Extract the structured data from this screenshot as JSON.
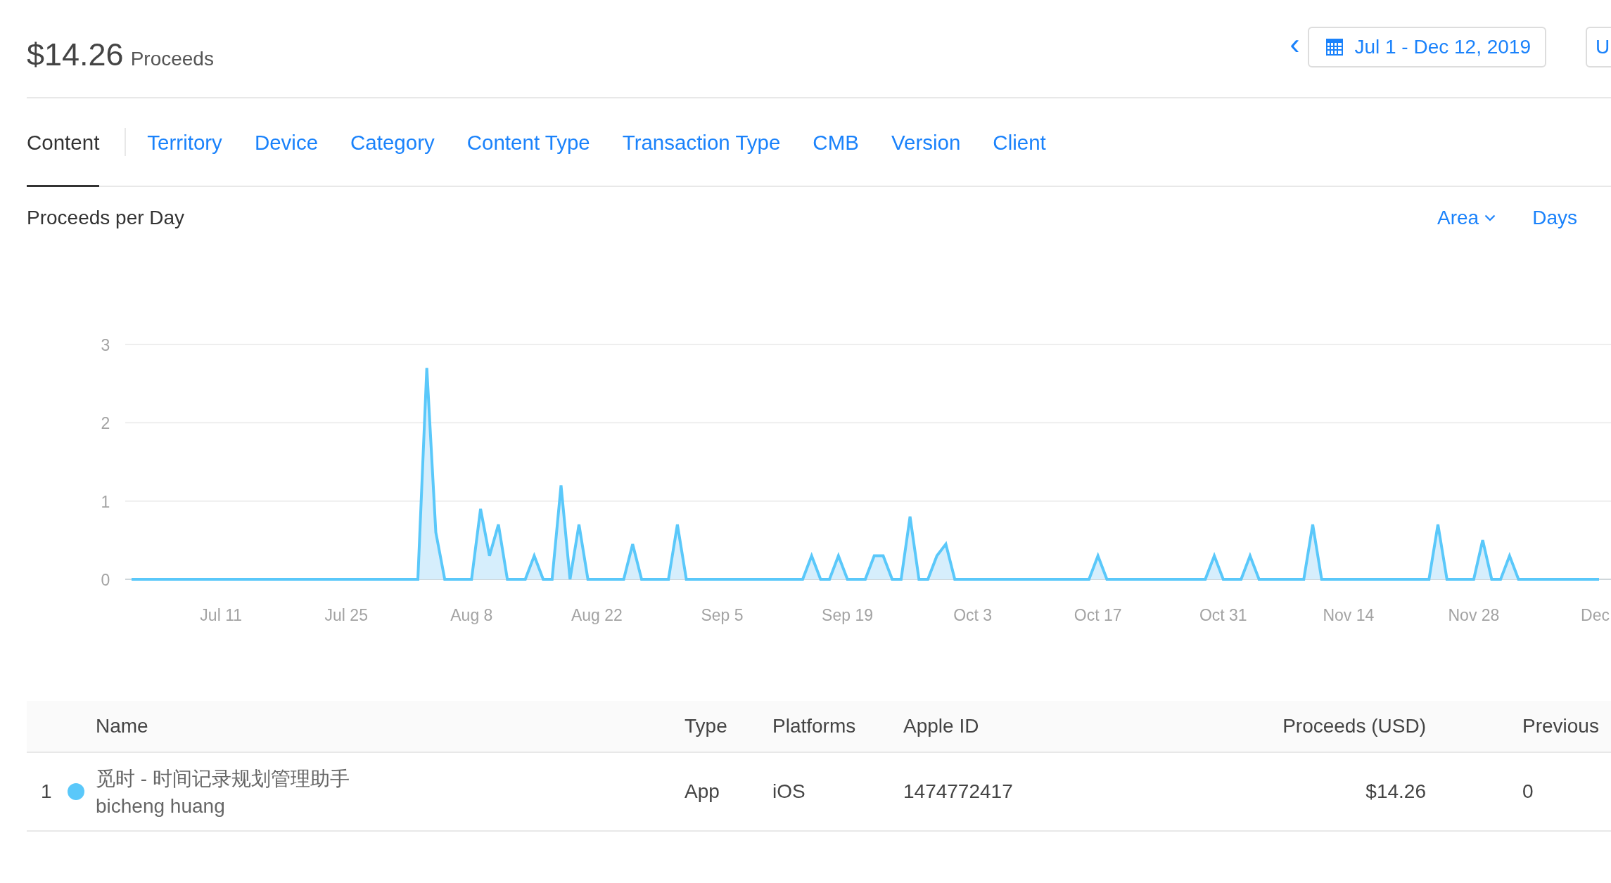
{
  "header": {
    "amount": "$14.26",
    "label": "Proceeds",
    "prev_button": "‹",
    "date_range": "Jul 1 - Dec 12, 2019",
    "next_button": "U"
  },
  "tabs": [
    {
      "label": "Content",
      "selected": true
    },
    {
      "label": "Territory",
      "selected": false
    },
    {
      "label": "Device",
      "selected": false
    },
    {
      "label": "Category",
      "selected": false
    },
    {
      "label": "Content Type",
      "selected": false
    },
    {
      "label": "Transaction Type",
      "selected": false
    },
    {
      "label": "CMB",
      "selected": false
    },
    {
      "label": "Version",
      "selected": false
    },
    {
      "label": "Client",
      "selected": false
    }
  ],
  "chart": {
    "chart_type_menu": "Area",
    "interval_menu": "Days",
    "chart_data": {
      "type": "area",
      "title": "Proceeds per Day",
      "categories": [
        null,
        null,
        null,
        null,
        null,
        null,
        null,
        null,
        null,
        null,
        "Jul 11",
        null,
        null,
        null,
        null,
        null,
        null,
        null,
        null,
        null,
        null,
        null,
        null,
        null,
        "Jul 25",
        null,
        null,
        null,
        null,
        null,
        null,
        null,
        null,
        null,
        null,
        null,
        null,
        null,
        "Aug 8",
        null,
        null,
        null,
        null,
        null,
        null,
        null,
        null,
        null,
        null,
        null,
        null,
        null,
        "Aug 22",
        null,
        null,
        null,
        null,
        null,
        null,
        null,
        null,
        null,
        null,
        null,
        null,
        null,
        "Sep 5",
        null,
        null,
        null,
        null,
        null,
        null,
        null,
        null,
        null,
        null,
        null,
        null,
        null,
        "Sep 19",
        null,
        null,
        null,
        null,
        null,
        null,
        null,
        null,
        null,
        null,
        null,
        null,
        null,
        "Oct 3",
        null,
        null,
        null,
        null,
        null,
        null,
        null,
        null,
        null,
        null,
        null,
        null,
        null,
        "Oct 17",
        null,
        null,
        null,
        null,
        null,
        null,
        null,
        null,
        null,
        null,
        null,
        null,
        null,
        "Oct 31",
        null,
        null,
        null,
        null,
        null,
        null,
        null,
        null,
        null,
        null,
        null,
        null,
        null,
        "Nov 14",
        null,
        null,
        null,
        null,
        null,
        null,
        null,
        null,
        null,
        null,
        null,
        null,
        null,
        "Nov 28",
        null,
        null,
        null,
        null,
        null,
        null,
        null,
        null,
        null,
        null,
        null,
        null,
        null,
        "Dec"
      ],
      "series": [
        {
          "color": "#5ac8fa",
          "values": [
            0,
            0,
            0,
            0,
            0,
            0,
            0,
            0,
            0,
            0,
            0,
            0,
            0,
            0,
            0,
            0,
            0,
            0,
            0,
            0,
            0,
            0,
            0,
            0,
            0,
            0,
            0,
            0,
            0,
            0,
            0,
            0,
            0,
            2.7,
            0.6,
            0,
            0,
            0,
            0,
            0.9,
            0.3,
            0.7,
            0,
            0,
            0,
            0.3,
            0,
            0,
            1.2,
            0,
            0.7,
            0,
            0,
            0,
            0,
            0,
            0.45,
            0,
            0,
            0,
            0,
            0.7,
            0,
            0,
            0,
            0,
            0,
            0,
            0,
            0,
            0,
            0,
            0,
            0,
            0,
            0,
            0.3,
            0,
            0,
            0.3,
            0,
            0,
            0,
            0.3,
            0.3,
            0,
            0,
            0.8,
            0,
            0,
            0.3,
            0.45,
            0,
            0,
            0,
            0,
            0,
            0,
            0,
            0,
            0,
            0,
            0,
            0,
            0,
            0,
            0,
            0,
            0.3,
            0,
            0,
            0,
            0,
            0,
            0,
            0,
            0,
            0,
            0,
            0,
            0,
            0.3,
            0,
            0,
            0,
            0.3,
            0,
            0,
            0,
            0,
            0,
            0,
            0.7,
            0,
            0,
            0,
            0,
            0,
            0,
            0,
            0,
            0,
            0,
            0,
            0,
            0,
            0.7,
            0,
            0,
            0,
            0,
            0.5,
            0,
            0,
            0.3,
            0,
            0,
            0,
            0,
            0,
            0,
            0,
            0,
            0,
            0
          ]
        }
      ],
      "ylim": [
        0,
        3
      ],
      "yticks": [
        0,
        1,
        2,
        3
      ]
    }
  },
  "table": {
    "columns": [
      "Name",
      "Type",
      "Platforms",
      "Apple ID",
      "Proceeds (USD)",
      "Previous"
    ],
    "rows": [
      {
        "index": "1",
        "color": "#5ac8fa",
        "name": "觅时 - 时间记录规划管理助手",
        "developer": "bicheng huang",
        "type": "App",
        "platforms": "iOS",
        "apple_id": "1474772417",
        "proceeds": "$14.26",
        "previous": "0"
      }
    ]
  }
}
